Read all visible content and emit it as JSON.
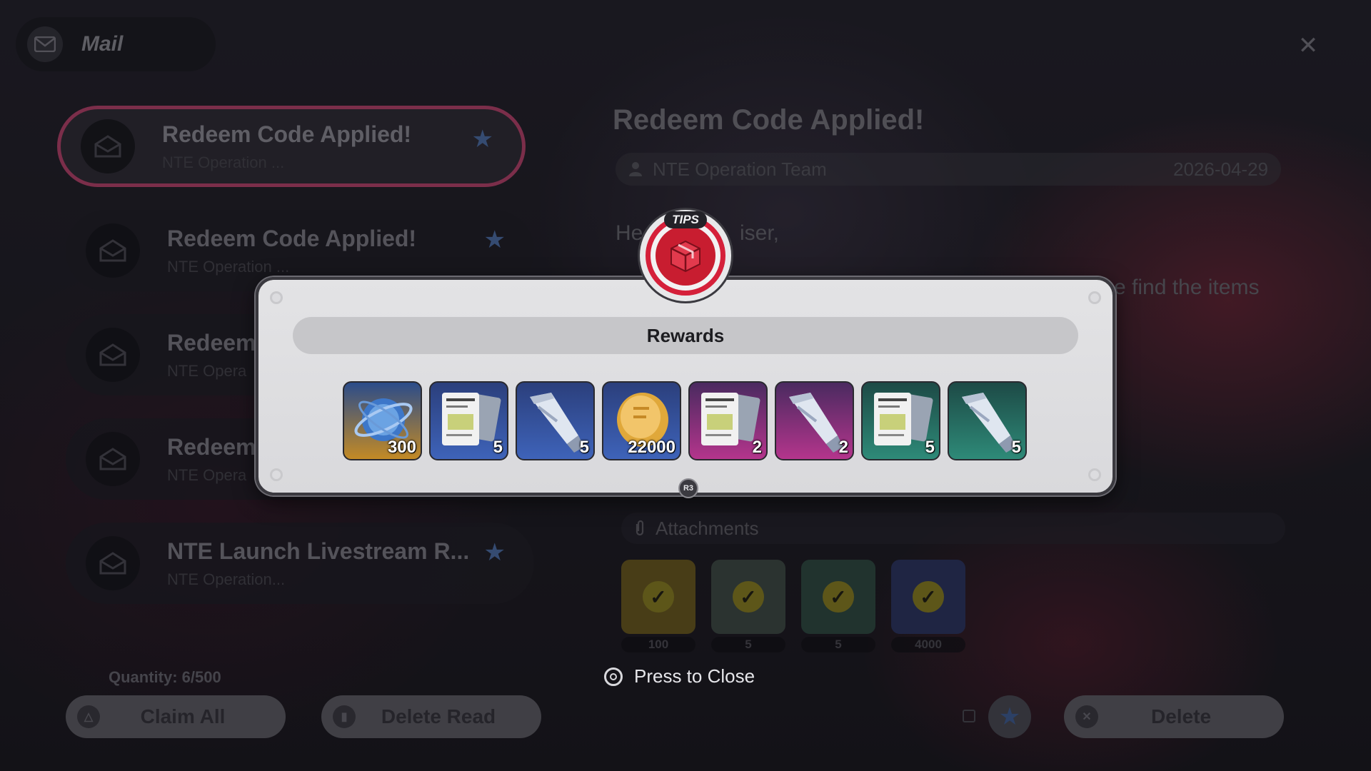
{
  "header": {
    "title": "Mail",
    "icon": "envelope-icon",
    "close_icon": "close-icon"
  },
  "mail_list": {
    "items": [
      {
        "subject": "Redeem Code Applied!",
        "sender": "NTE Operation ...",
        "starred": true,
        "selected": true
      },
      {
        "subject": "Redeem Code Applied!",
        "sender": "NTE Operation ...",
        "starred": true,
        "selected": false
      },
      {
        "subject": "Redeem",
        "sender": "NTE Opera",
        "starred": false,
        "selected": false
      },
      {
        "subject": "Redeem",
        "sender": "NTE Opera",
        "starred": false,
        "selected": false
      },
      {
        "subject": "NTE Launch Livestream R...",
        "sender": "NTE Operation...",
        "starred": true,
        "selected": false
      }
    ],
    "quantity": "Quantity: 6/500"
  },
  "footer": {
    "claim_all": "Claim All",
    "delete_read": "Delete Read",
    "delete": "Delete"
  },
  "detail": {
    "title": "Redeem Code Applied!",
    "sender": "NTE Operation Team",
    "date": "2026-04-29",
    "greeting": "He",
    "greeting_tail": "iser,",
    "body_tail": "e find the items",
    "attachments_label": "Attachments",
    "attachments": [
      {
        "qty": "100",
        "color": "#6a5a1c"
      },
      {
        "qty": "5",
        "color": "#3e4a42"
      },
      {
        "qty": "5",
        "color": "#2f4a40"
      },
      {
        "qty": "4000",
        "color": "#2c3560"
      }
    ]
  },
  "modal": {
    "badge": "TIPS",
    "title": "Rewards",
    "r3_label": "R3",
    "rewards": [
      {
        "name": "orb",
        "qty": "300",
        "bg_top": "#2b4c8a",
        "bg_bottom": "#c38a25"
      },
      {
        "name": "document-blue",
        "qty": "5",
        "bg_top": "#2b3f7c",
        "bg_bottom": "#3e63b9"
      },
      {
        "name": "tube-blue",
        "qty": "5",
        "bg_top": "#2b3f7c",
        "bg_bottom": "#3e63b9"
      },
      {
        "name": "coin",
        "qty": "22000",
        "bg_top": "#2b3f7c",
        "bg_bottom": "#3e63b9"
      },
      {
        "name": "document-purple",
        "qty": "2",
        "bg_top": "#4a2a60",
        "bg_bottom": "#b4358c"
      },
      {
        "name": "tube-purple",
        "qty": "2",
        "bg_top": "#4a2a60",
        "bg_bottom": "#b4358c"
      },
      {
        "name": "document-green",
        "qty": "5",
        "bg_top": "#1d4a46",
        "bg_bottom": "#2e8a78"
      },
      {
        "name": "tube-green",
        "qty": "5",
        "bg_top": "#1d4a46",
        "bg_bottom": "#2e8a78"
      }
    ]
  },
  "press_close": "Press to Close"
}
